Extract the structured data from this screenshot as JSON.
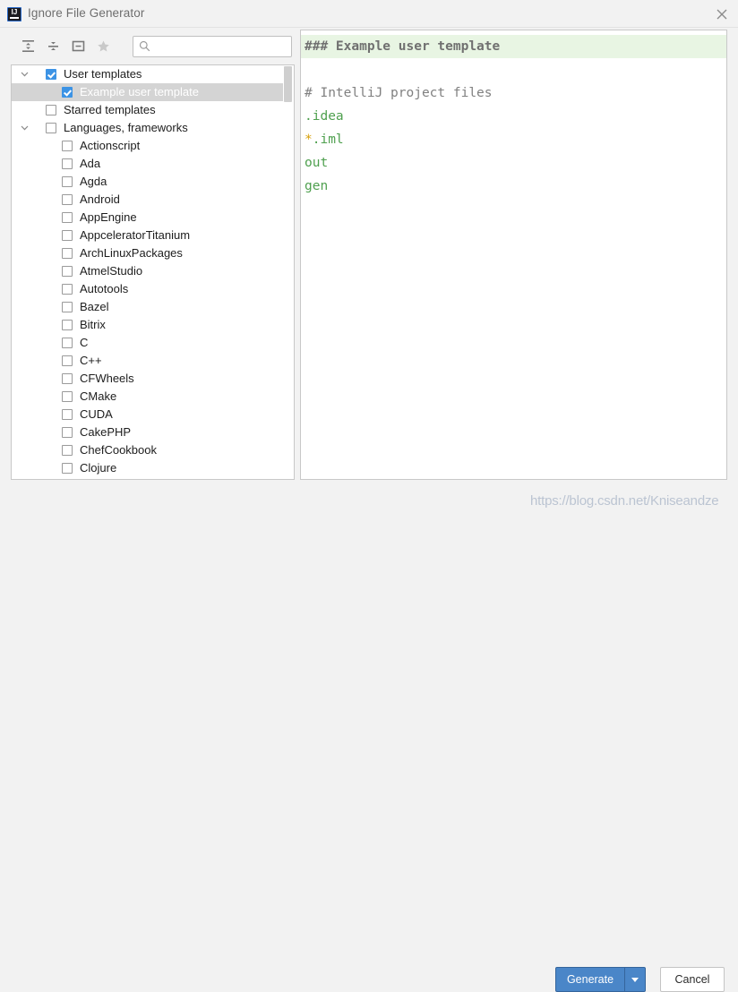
{
  "window": {
    "title": "Ignore File Generator",
    "app_icon_letters": "IJ",
    "close_icon": "close-icon"
  },
  "toolbar": {
    "expand_all": {
      "icon": "expand-all-icon",
      "tooltip": "Expand All"
    },
    "collapse_all": {
      "icon": "collapse-all-icon",
      "tooltip": "Collapse All"
    },
    "collapse": {
      "icon": "collapse-icon",
      "tooltip": "Collapse"
    },
    "star": {
      "icon": "star-icon",
      "tooltip": "Starred"
    }
  },
  "search": {
    "icon": "search-icon",
    "value": "",
    "placeholder": ""
  },
  "tree": {
    "rows": [
      {
        "label": "User templates",
        "depth": 0,
        "checked": true,
        "twisty": "down",
        "selected": false
      },
      {
        "label": "Example user template",
        "depth": 1,
        "checked": true,
        "twisty": "none",
        "selected": true
      },
      {
        "label": "Starred templates",
        "depth": 0,
        "checked": false,
        "twisty": "none",
        "selected": false
      },
      {
        "label": "Languages, frameworks",
        "depth": 0,
        "checked": false,
        "twisty": "down",
        "selected": false
      },
      {
        "label": "Actionscript",
        "depth": 1,
        "checked": false,
        "twisty": "none",
        "selected": false
      },
      {
        "label": "Ada",
        "depth": 1,
        "checked": false,
        "twisty": "none",
        "selected": false
      },
      {
        "label": "Agda",
        "depth": 1,
        "checked": false,
        "twisty": "none",
        "selected": false
      },
      {
        "label": "Android",
        "depth": 1,
        "checked": false,
        "twisty": "none",
        "selected": false
      },
      {
        "label": "AppEngine",
        "depth": 1,
        "checked": false,
        "twisty": "none",
        "selected": false
      },
      {
        "label": "AppceleratorTitanium",
        "depth": 1,
        "checked": false,
        "twisty": "none",
        "selected": false
      },
      {
        "label": "ArchLinuxPackages",
        "depth": 1,
        "checked": false,
        "twisty": "none",
        "selected": false
      },
      {
        "label": "AtmelStudio",
        "depth": 1,
        "checked": false,
        "twisty": "none",
        "selected": false
      },
      {
        "label": "Autotools",
        "depth": 1,
        "checked": false,
        "twisty": "none",
        "selected": false
      },
      {
        "label": "Bazel",
        "depth": 1,
        "checked": false,
        "twisty": "none",
        "selected": false
      },
      {
        "label": "Bitrix",
        "depth": 1,
        "checked": false,
        "twisty": "none",
        "selected": false
      },
      {
        "label": "C",
        "depth": 1,
        "checked": false,
        "twisty": "none",
        "selected": false
      },
      {
        "label": "C++",
        "depth": 1,
        "checked": false,
        "twisty": "none",
        "selected": false
      },
      {
        "label": "CFWheels",
        "depth": 1,
        "checked": false,
        "twisty": "none",
        "selected": false
      },
      {
        "label": "CMake",
        "depth": 1,
        "checked": false,
        "twisty": "none",
        "selected": false
      },
      {
        "label": "CUDA",
        "depth": 1,
        "checked": false,
        "twisty": "none",
        "selected": false
      },
      {
        "label": "CakePHP",
        "depth": 1,
        "checked": false,
        "twisty": "none",
        "selected": false
      },
      {
        "label": "ChefCookbook",
        "depth": 1,
        "checked": false,
        "twisty": "none",
        "selected": false
      },
      {
        "label": "Clojure",
        "depth": 1,
        "checked": false,
        "twisty": "none",
        "selected": false
      }
    ]
  },
  "editor": {
    "lines": [
      {
        "style": "header",
        "segments": [
          {
            "text": "### Example user template",
            "color": "header"
          }
        ]
      },
      {
        "style": "plain",
        "segments": [
          {
            "text": "",
            "color": "green"
          }
        ]
      },
      {
        "style": "plain",
        "segments": [
          {
            "text": "# IntelliJ project files",
            "color": "comment"
          }
        ]
      },
      {
        "style": "plain",
        "segments": [
          {
            "text": ".idea",
            "color": "green"
          }
        ]
      },
      {
        "style": "plain",
        "segments": [
          {
            "text": "*",
            "color": "orange"
          },
          {
            "text": ".iml",
            "color": "green"
          }
        ]
      },
      {
        "style": "plain",
        "segments": [
          {
            "text": "out",
            "color": "green"
          }
        ]
      },
      {
        "style": "plain",
        "segments": [
          {
            "text": "gen",
            "color": "green"
          }
        ]
      }
    ]
  },
  "footer": {
    "generate_label": "Generate",
    "generate_dropdown_icon": "chevron-down-icon",
    "cancel_label": "Cancel"
  },
  "watermark": {
    "text": "https://blog.csdn.net/Kniseandze"
  },
  "colors": {
    "accent_blue": "#4a86c8",
    "checkbox_blue": "#3c93e5",
    "selection_grey": "#d4d4d4",
    "code_green": "#4fa04f",
    "code_orange": "#d8a00a",
    "code_comment": "#808080",
    "header_bg": "#e8f5e3",
    "window_bg": "#f2f2f2"
  }
}
